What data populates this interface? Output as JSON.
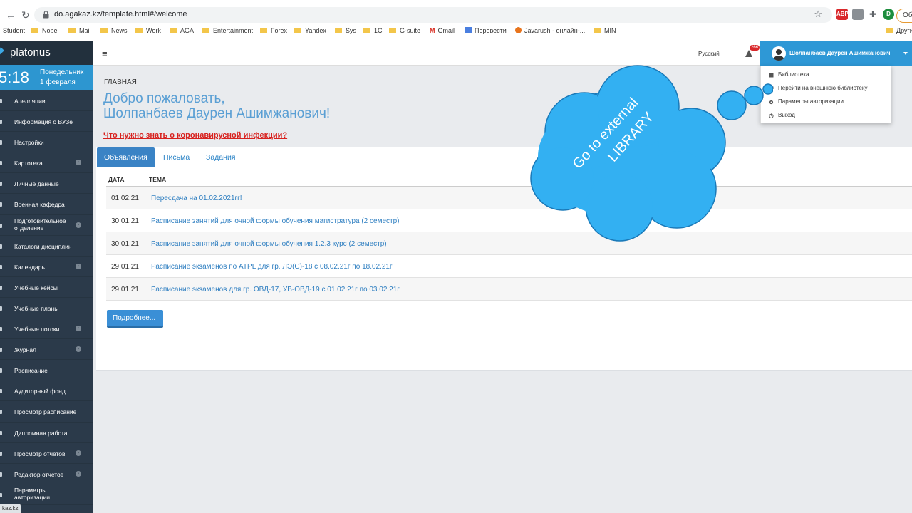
{
  "browser": {
    "url": "do.agakaz.kz/template.html#/welcome",
    "profile_label": "Об",
    "extensions": [
      {
        "name": "abp-icon",
        "label": "ABP",
        "color": "#d9292c"
      },
      {
        "name": "screen-icon",
        "label": "",
        "color": "#5f6368"
      },
      {
        "name": "puzzle-icon",
        "label": "",
        "color": "#5f6368"
      },
      {
        "name": "profile-icon",
        "label": "D",
        "color": "#1e8e3e"
      }
    ],
    "bookmarks": [
      "Student",
      "Nobel",
      "Mail",
      "News",
      "Work",
      "AGA",
      "Entertainment",
      "Forex",
      "Yandex",
      "Sys",
      "1C",
      "G-suite",
      "Gmail",
      "Перевести",
      "Javarush - онлайн-...",
      "MIN"
    ],
    "bookmarks_other": "Други"
  },
  "sidebar": {
    "logo": "platonus",
    "time": "5:18",
    "weekday": "Понедельник",
    "date": "1 февраля",
    "items": [
      {
        "label": "Апелляции",
        "chevron": false,
        "two": false
      },
      {
        "label": "Информация о ВУЗе",
        "chevron": false,
        "two": false
      },
      {
        "label": "Настройки",
        "chevron": false,
        "two": false
      },
      {
        "label": "Картотека",
        "chevron": true,
        "two": false
      },
      {
        "label": "Личные данные",
        "chevron": false,
        "two": false
      },
      {
        "label": "Военная кафедра",
        "chevron": false,
        "two": false
      },
      {
        "label": "Подготовительное отделение",
        "chevron": true,
        "two": true
      },
      {
        "label": "Каталоги дисциплин",
        "chevron": false,
        "two": false
      },
      {
        "label": "Календарь",
        "chevron": true,
        "two": false
      },
      {
        "label": "Учебные кейсы",
        "chevron": false,
        "two": false
      },
      {
        "label": "Учебные планы",
        "chevron": false,
        "two": false
      },
      {
        "label": "Учебные потоки",
        "chevron": true,
        "two": false
      },
      {
        "label": "Журнал",
        "chevron": true,
        "two": false
      },
      {
        "label": "Расписание",
        "chevron": false,
        "two": false
      },
      {
        "label": "Аудиторный фонд",
        "chevron": false,
        "two": false
      },
      {
        "label": "Просмотр расписание",
        "chevron": false,
        "two": false
      },
      {
        "label": "Дипломная работа",
        "chevron": false,
        "two": false
      },
      {
        "label": "Просмотр отчетов",
        "chevron": true,
        "two": false
      },
      {
        "label": "Редактор отчетов",
        "chevron": true,
        "two": false
      },
      {
        "label": "Параметры авторизации",
        "chevron": false,
        "two": true
      }
    ],
    "status_tip": "kaz.kz"
  },
  "topbar": {
    "language": "Русский",
    "notifications": "266",
    "user_name": "Шолпанбаев Даурен Ашимжанович"
  },
  "dropdown": {
    "items": [
      {
        "label": "Библиотека",
        "icon": "book-icon"
      },
      {
        "label": "Перейти на внешнюю библиотеку",
        "icon": "external-link-icon"
      },
      {
        "label": "Параметры авторизации",
        "icon": "gear-icon"
      },
      {
        "label": "Выход",
        "icon": "power-icon"
      }
    ]
  },
  "main": {
    "crumb": "ГЛАВНАЯ",
    "welcome_line1": "Добро пожаловать,",
    "welcome_line2": "Шолпанбаев Даурен Ашимжанович!",
    "covid_link": "Что нужно знать о коронавирусной инфекции?",
    "tabs": [
      "Объявления",
      "Письма",
      "Задания"
    ],
    "table": {
      "headers": [
        "ДАТА",
        "ТЕМА"
      ],
      "rows": [
        {
          "date": "01.02.21",
          "topic": "Пересдача на 01.02.2021гг!"
        },
        {
          "date": "30.01.21",
          "topic": "Расписание занятий для очной формы обучения магистратура (2 семестр)"
        },
        {
          "date": "30.01.21",
          "topic": "Расписание занятий для очной формы обучения 1.2.3 курс (2 семестр)"
        },
        {
          "date": "29.01.21",
          "topic": "Расписание экзаменов по ATPL для гр. ЛЭ(С)-18 с 08.02.21г по 18.02.21г"
        },
        {
          "date": "29.01.21",
          "topic": "Расписание экзаменов для гр. ОВД-17, УВ-ОВД-19 с 01.02.21г по 03.02.21г"
        }
      ]
    },
    "more_button": "Подробнее..."
  },
  "callout": {
    "line1": "Go to external",
    "line2": "LIBRARY",
    "color": "#33b0f2"
  }
}
